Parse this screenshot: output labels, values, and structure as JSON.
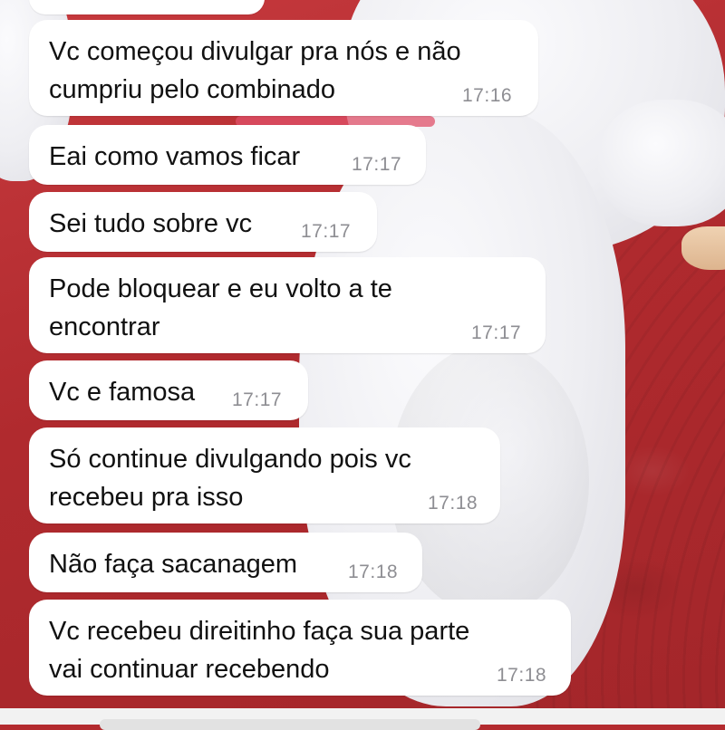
{
  "conversation": {
    "messages": [
      {
        "text": "Vc começou divulgar pra nós e não\ncumpriu pelo combinado",
        "time": "17:16"
      },
      {
        "text": "Eai como vamos ficar",
        "time": "17:17"
      },
      {
        "text": "Sei tudo sobre vc",
        "time": "17:17"
      },
      {
        "text": "Pode bloquear e eu volto a te\nencontrar",
        "time": "17:17"
      },
      {
        "text": "Vc e famosa",
        "time": "17:17"
      },
      {
        "text": "Só continue divulgando pois vc\nrecebeu pra isso",
        "time": "17:18"
      },
      {
        "text": "Não faça sacanagem",
        "time": "17:18"
      },
      {
        "text": "Vc recebeu direitinho faça sua parte\nvai continuar recebendo",
        "time": "17:18"
      }
    ]
  },
  "colors": {
    "bubble": "#ffffff",
    "text": "#111111",
    "timestamp": "#8e8e93",
    "wallpaper_red": "#b32b2f",
    "wallpaper_cloth": "#eeeef2"
  }
}
